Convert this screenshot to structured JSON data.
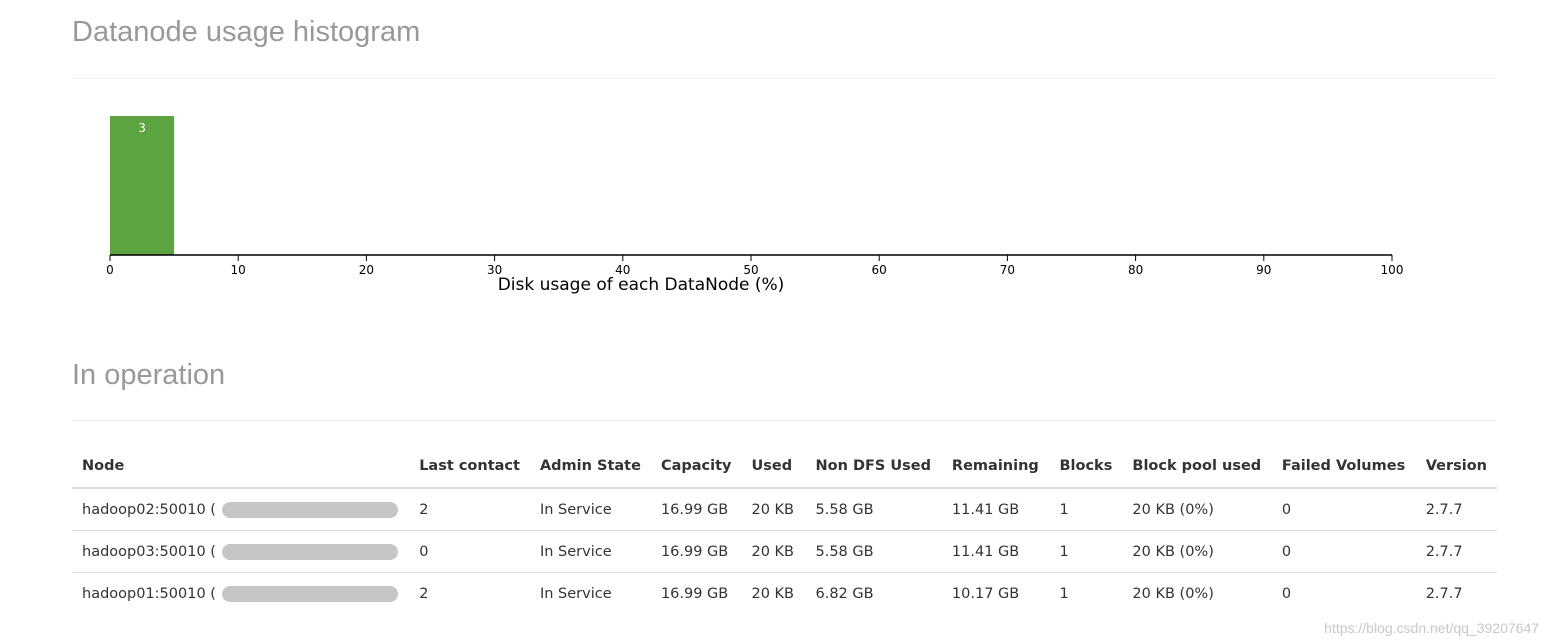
{
  "histogram_section": {
    "title": "Datanode usage histogram"
  },
  "operation_section": {
    "title": "In operation"
  },
  "chart_data": {
    "type": "bar",
    "title": "",
    "xlabel": "Disk usage of each DataNode (%)",
    "ylabel": "",
    "xlim": [
      0,
      100
    ],
    "x_ticks": [
      0,
      10,
      20,
      30,
      40,
      50,
      60,
      70,
      80,
      90,
      100
    ],
    "bins": [
      {
        "x0": 0,
        "x1": 5,
        "count": 3
      }
    ],
    "ylim": [
      0,
      3
    ],
    "grid": false,
    "colors": {
      "bar": "#5ca43f",
      "bar_label": "#ffffff",
      "axis": "#000000"
    }
  },
  "table": {
    "columns": [
      "Node",
      "Last contact",
      "Admin State",
      "Capacity",
      "Used",
      "Non DFS Used",
      "Remaining",
      "Blocks",
      "Block pool used",
      "Failed Volumes",
      "Version"
    ],
    "rows": [
      {
        "node": "hadoop02:50010 (",
        "last_contact": "2",
        "admin_state": "In Service",
        "capacity": "16.99 GB",
        "used": "20 KB",
        "non_dfs_used": "5.58 GB",
        "remaining": "11.41 GB",
        "blocks": "1",
        "block_pool_used": "20 KB (0%)",
        "failed_volumes": "0",
        "version": "2.7.7"
      },
      {
        "node": "hadoop03:50010 (",
        "last_contact": "0",
        "admin_state": "In Service",
        "capacity": "16.99 GB",
        "used": "20 KB",
        "non_dfs_used": "5.58 GB",
        "remaining": "11.41 GB",
        "blocks": "1",
        "block_pool_used": "20 KB (0%)",
        "failed_volumes": "0",
        "version": "2.7.7"
      },
      {
        "node": "hadoop01:50010 (",
        "last_contact": "2",
        "admin_state": "In Service",
        "capacity": "16.99 GB",
        "used": "20 KB",
        "non_dfs_used": "6.82 GB",
        "remaining": "10.17 GB",
        "blocks": "1",
        "block_pool_used": "20 KB (0%)",
        "failed_volumes": "0",
        "version": "2.7.7"
      }
    ]
  },
  "watermark": "https://blog.csdn.net/qq_39207647"
}
